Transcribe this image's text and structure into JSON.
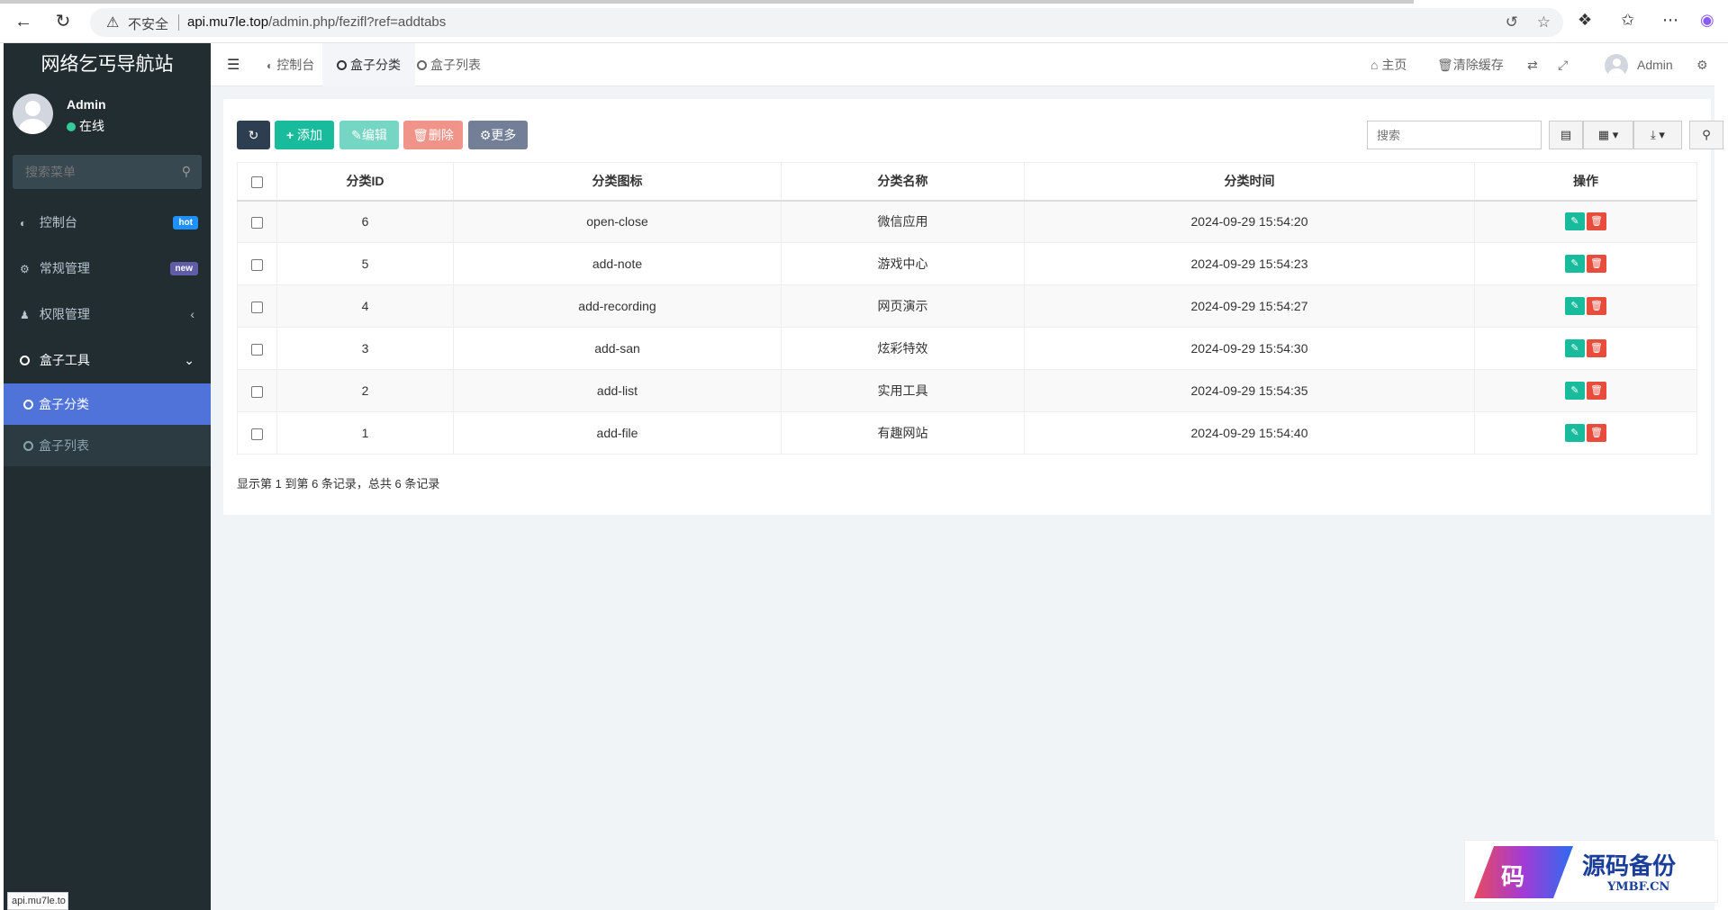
{
  "browser": {
    "insecure_label": "不安全",
    "url_host": "api.mu7le.top",
    "url_path": "/admin.php/fezifl?ref=addtabs",
    "status_url": "api.mu7le.to"
  },
  "sidebar": {
    "logo": "网络乞丐导航站",
    "user_name": "Admin",
    "user_status": "在线",
    "search_placeholder": "搜索菜单",
    "menu": [
      {
        "label": "控制台",
        "badge": "hot",
        "badge_color": "#1e90ff"
      },
      {
        "label": "常规管理",
        "badge": "new",
        "badge_color": "#605ca8"
      },
      {
        "label": "权限管理"
      },
      {
        "label": "盒子工具"
      }
    ],
    "submenu": [
      {
        "label": "盒子分类",
        "active": true
      },
      {
        "label": "盒子列表",
        "active": false
      }
    ]
  },
  "header": {
    "tabs": [
      "控制台",
      "盒子分类",
      "盒子列表"
    ],
    "home": "主页",
    "clear_cache": "清除缓存",
    "user": "Admin"
  },
  "toolbar": {
    "add": "添加",
    "edit": "编辑",
    "delete": "删除",
    "more": "更多",
    "search_placeholder": "搜索"
  },
  "table": {
    "columns": [
      "分类ID",
      "分类图标",
      "分类名称",
      "分类时间",
      "操作"
    ],
    "rows": [
      {
        "id": "6",
        "icon": "open-close",
        "name": "微信应用",
        "time": "2024-09-29 15:54:20"
      },
      {
        "id": "5",
        "icon": "add-note",
        "name": "游戏中心",
        "time": "2024-09-29 15:54:23"
      },
      {
        "id": "4",
        "icon": "add-recording",
        "name": "网页演示",
        "time": "2024-09-29 15:54:27"
      },
      {
        "id": "3",
        "icon": "add-san",
        "name": "炫彩特效",
        "time": "2024-09-29 15:54:30"
      },
      {
        "id": "2",
        "icon": "add-list",
        "name": "实用工具",
        "time": "2024-09-29 15:54:35"
      },
      {
        "id": "1",
        "icon": "add-file",
        "name": "有趣网站",
        "time": "2024-09-29 15:54:40"
      }
    ],
    "pager_text": "显示第 1 到第 6 条记录，总共 6 条记录"
  },
  "watermark": {
    "glyph": "码",
    "title": "源码备份",
    "domain": "YMBF.CN"
  },
  "colors": {
    "sidebar_bg": "#222d32",
    "active_menu": "#4f73d8",
    "success": "#18bc9c",
    "danger": "#e74c3c"
  }
}
